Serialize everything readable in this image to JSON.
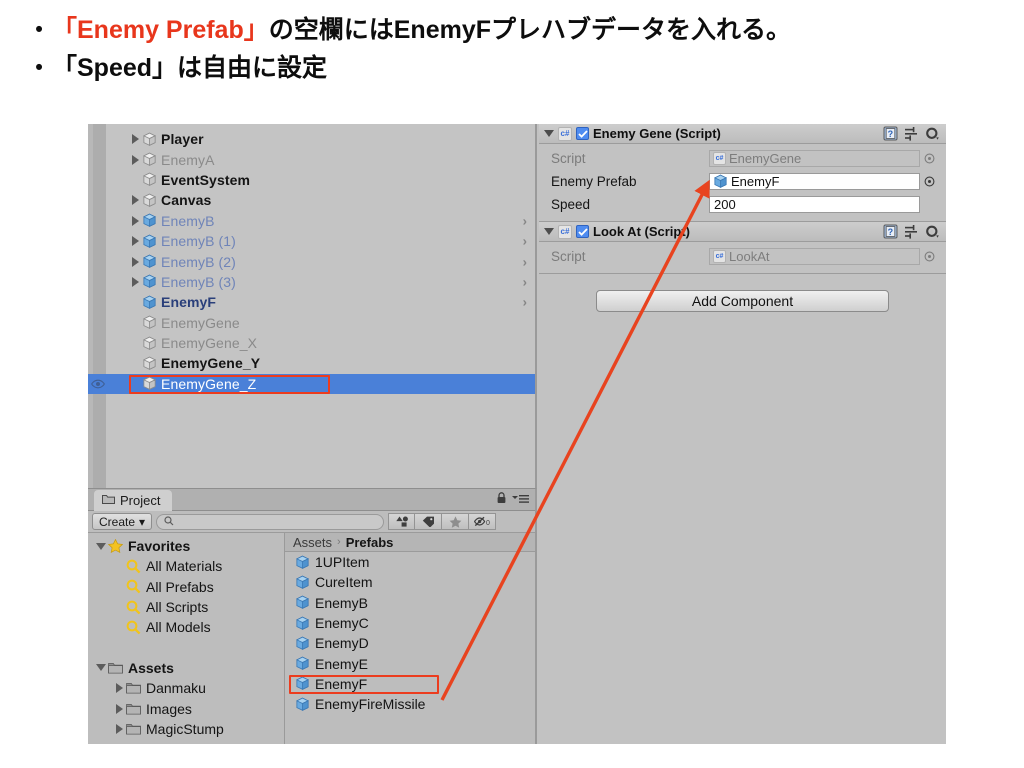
{
  "slide": {
    "bullets": [
      {
        "marker": "•",
        "pre": "",
        "highlight": "「Enemy Prefab」",
        "post": "の空欄にはEnemyFプレハブデータを入れる。"
      },
      {
        "marker": "•",
        "pre": "",
        "highlight": "",
        "post": "「Speed」は自由に設定"
      }
    ],
    "highlight_color": "#e8361c"
  },
  "hierarchy": {
    "rows": [
      {
        "label": "Player",
        "indent": 1,
        "expandable": true,
        "style": "normal",
        "cube": "grey",
        "chevron": false
      },
      {
        "label": "EnemyA",
        "indent": 1,
        "expandable": true,
        "style": "dim",
        "cube": "grey",
        "chevron": false
      },
      {
        "label": "EventSystem",
        "indent": 1,
        "expandable": false,
        "style": "normal",
        "cube": "grey",
        "chevron": false
      },
      {
        "label": "Canvas",
        "indent": 1,
        "expandable": true,
        "style": "normal",
        "cube": "grey",
        "chevron": false
      },
      {
        "label": "EnemyB",
        "indent": 1,
        "expandable": true,
        "style": "prefab",
        "cube": "blue",
        "chevron": true
      },
      {
        "label": "EnemyB (1)",
        "indent": 1,
        "expandable": true,
        "style": "prefab",
        "cube": "blue",
        "chevron": true
      },
      {
        "label": "EnemyB (2)",
        "indent": 1,
        "expandable": true,
        "style": "prefab",
        "cube": "blue",
        "chevron": true
      },
      {
        "label": "EnemyB (3)",
        "indent": 1,
        "expandable": true,
        "style": "prefab",
        "cube": "blue",
        "chevron": true
      },
      {
        "label": "EnemyF",
        "indent": 1,
        "expandable": false,
        "style": "prefab-bold",
        "cube": "blue",
        "chevron": true
      },
      {
        "label": "EnemyGene",
        "indent": 1,
        "expandable": false,
        "style": "dim",
        "cube": "grey",
        "chevron": false
      },
      {
        "label": "EnemyGene_X",
        "indent": 1,
        "expandable": false,
        "style": "dim",
        "cube": "grey",
        "chevron": false
      },
      {
        "label": "EnemyGene_Y",
        "indent": 1,
        "expandable": false,
        "style": "normal",
        "cube": "grey",
        "chevron": false
      },
      {
        "label": "EnemyGene_Z",
        "indent": 1,
        "expandable": false,
        "style": "selected",
        "cube": "grey",
        "chevron": false,
        "selected": true,
        "outlined": true,
        "eye": true
      }
    ]
  },
  "project": {
    "tab_label": "Project",
    "tab_icon": "folder-icon",
    "lock_icon": "lock-icon",
    "menu_icon": "panel-menu-icon",
    "create_label": "Create",
    "create_caret": "▾",
    "search_placeholder": "",
    "search_value": "",
    "search_icon": "search-icon",
    "toolbar_icons": [
      "type-filter-icon",
      "label-filter-icon",
      "favorite-star-icon",
      "visibility-toggle-icon"
    ],
    "breadcrumb": {
      "root": "Assets",
      "separator": "›",
      "current": "Prefabs"
    },
    "tree": [
      {
        "label": "Favorites",
        "type": "root",
        "icon": "star-icon",
        "expanded": true,
        "indent": 0
      },
      {
        "label": "All Materials",
        "type": "search",
        "icon": "search-icon",
        "expanded": false,
        "indent": 1
      },
      {
        "label": "All Prefabs",
        "type": "search",
        "icon": "search-icon",
        "expanded": false,
        "indent": 1
      },
      {
        "label": "All Scripts",
        "type": "search",
        "icon": "search-icon",
        "expanded": false,
        "indent": 1
      },
      {
        "label": "All Models",
        "type": "search",
        "icon": "search-icon",
        "expanded": false,
        "indent": 1
      },
      {
        "label": "",
        "type": "spacer",
        "icon": "",
        "expanded": false,
        "indent": 0
      },
      {
        "label": "Assets",
        "type": "root",
        "icon": "folder-icon",
        "expanded": true,
        "indent": 0
      },
      {
        "label": "Danmaku",
        "type": "folder",
        "icon": "folder-icon",
        "expanded": false,
        "indent": 1
      },
      {
        "label": "Images",
        "type": "folder",
        "icon": "folder-icon",
        "expanded": false,
        "indent": 1
      },
      {
        "label": "MagicStump",
        "type": "folder",
        "icon": "folder-icon",
        "expanded": false,
        "indent": 1
      }
    ],
    "assets": [
      {
        "label": "1UPItem",
        "icon": "prefab-cube-icon",
        "outlined": false
      },
      {
        "label": "CureItem",
        "icon": "prefab-cube-icon",
        "outlined": false
      },
      {
        "label": "EnemyB",
        "icon": "prefab-cube-icon",
        "outlined": false
      },
      {
        "label": "EnemyC",
        "icon": "prefab-cube-icon",
        "outlined": false
      },
      {
        "label": "EnemyD",
        "icon": "prefab-cube-icon",
        "outlined": false
      },
      {
        "label": "EnemyE",
        "icon": "prefab-cube-icon",
        "outlined": false
      },
      {
        "label": "EnemyF",
        "icon": "prefab-cube-icon",
        "outlined": true
      },
      {
        "label": "EnemyFireMissile",
        "icon": "prefab-cube-icon",
        "outlined": false
      }
    ]
  },
  "inspector": {
    "components": [
      {
        "title": "Enemy Gene (Script)",
        "enabled": true,
        "script_icon": "csharp-script-icon",
        "help_icon": "help-book-icon",
        "preset_icon": "preset-icon",
        "gear_icon": "gear-icon",
        "fields": [
          {
            "label": "Script",
            "type": "object",
            "value": "EnemyGene",
            "icon": "csharp-script-icon",
            "disabled": true,
            "picker": true
          },
          {
            "label": "Enemy Prefab",
            "type": "object",
            "value": "EnemyF",
            "icon": "prefab-cube-icon",
            "disabled": false,
            "picker": true
          },
          {
            "label": "Speed",
            "type": "number",
            "value": "200",
            "icon": "",
            "disabled": false,
            "picker": false
          }
        ]
      },
      {
        "title": "Look At (Script)",
        "enabled": true,
        "script_icon": "csharp-script-icon",
        "help_icon": "help-book-icon",
        "preset_icon": "preset-icon",
        "gear_icon": "gear-icon",
        "fields": [
          {
            "label": "Script",
            "type": "object",
            "value": "LookAt",
            "icon": "csharp-script-icon",
            "disabled": true,
            "picker": true
          }
        ]
      }
    ],
    "add_component_label": "Add Component"
  },
  "annotation": {
    "arrow_color": "#e8431f",
    "highlight_color": "#ec3c1e"
  }
}
